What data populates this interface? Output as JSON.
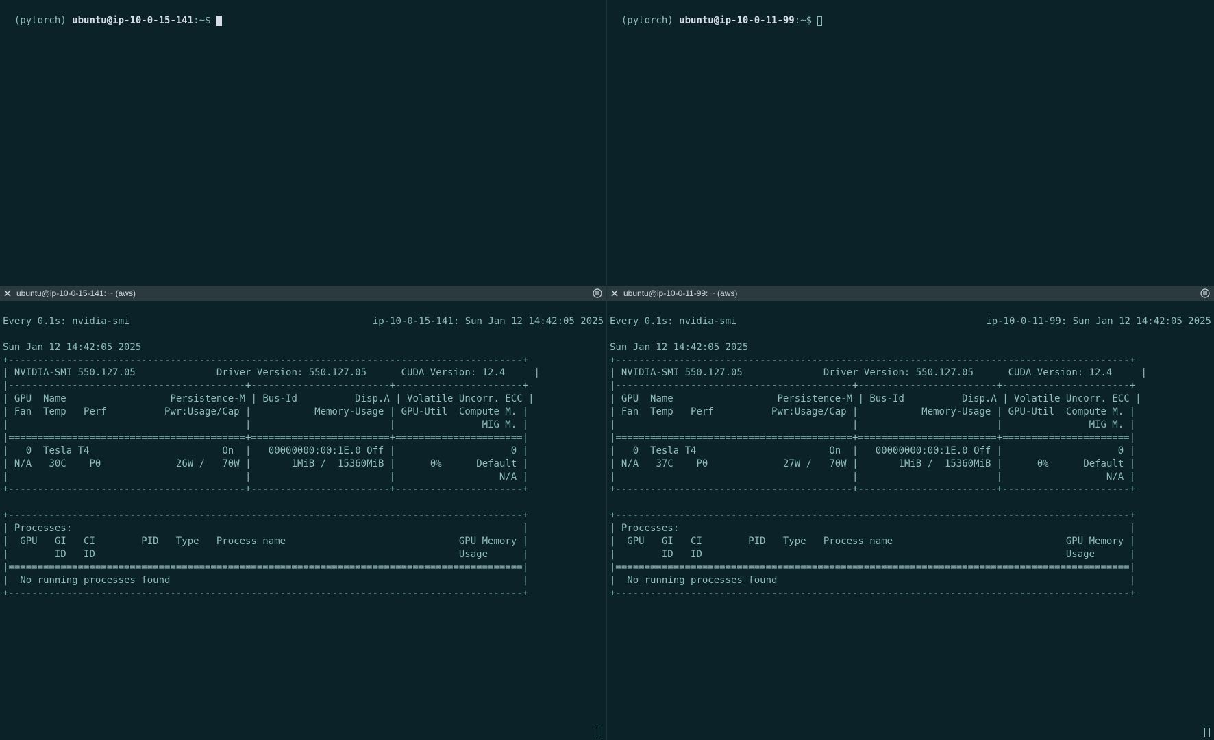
{
  "panes": {
    "top_left": {
      "prompt_env": "(pytorch) ",
      "prompt_userhost": "ubuntu@ip-10-0-15-141",
      "prompt_tail": ":~$ "
    },
    "top_right": {
      "prompt_env": "(pytorch) ",
      "prompt_userhost": "ubuntu@ip-10-0-11-99",
      "prompt_tail": ":~$ "
    }
  },
  "titlebars": {
    "left": "ubuntu@ip-10-0-15-141: ~ (aws)",
    "right": "ubuntu@ip-10-0-11-99: ~ (aws)"
  },
  "watch": {
    "interval_label": "Every 0.1s: nvidia-smi",
    "left_host_time": "ip-10-0-15-141: Sun Jan 12 14:42:05 2025",
    "right_host_time": "ip-10-0-11-99: Sun Jan 12 14:42:05 2025"
  },
  "smi": {
    "date_line": "Sun Jan 12 14:42:05 2025",
    "nvidia_smi_version": "NVIDIA-SMI 550.127.05",
    "driver_version": "Driver Version: 550.127.05",
    "cuda_version": "CUDA Version: 12.4",
    "header_row1_col1": " GPU  Name                  Persistence-M ",
    "header_row1_col2": " Bus-Id          Disp.A ",
    "header_row1_col3": " Volatile Uncorr. ECC ",
    "header_row2_col1": " Fan  Temp   Perf          Pwr:Usage/Cap ",
    "header_row2_col2": "           Memory-Usage ",
    "header_row2_col3": " GPU-Util  Compute M. ",
    "header_row3_col3": "               MIG M. ",
    "proc_header": "Processes:",
    "proc_cols1": "  GPU   GI   CI        PID   Type   Process name                              GPU Memory ",
    "proc_cols2": "        ID   ID                                                               Usage      ",
    "no_proc": "  No running processes found",
    "left": {
      "gpu_idx": "0",
      "gpu_name": "Tesla T4",
      "persistence": "On",
      "bus_id": "00000000:00:1E.0",
      "disp_a": "Off",
      "ecc": "0",
      "fan": "N/A",
      "temp": "30C",
      "perf": "P0",
      "pwr_usage": "26W",
      "pwr_cap": "70W",
      "mem_used": "1MiB",
      "mem_total": "15360MiB",
      "gpu_util": "0%",
      "compute_mode": "Default",
      "mig_mode": "N/A"
    },
    "right": {
      "gpu_idx": "0",
      "gpu_name": "Tesla T4",
      "persistence": "On",
      "bus_id": "00000000:00:1E.0",
      "disp_a": "Off",
      "ecc": "0",
      "fan": "N/A",
      "temp": "37C",
      "perf": "P0",
      "pwr_usage": "27W",
      "pwr_cap": "70W",
      "mem_used": "1MiB",
      "mem_total": "15360MiB",
      "gpu_util": "0%",
      "compute_mode": "Default",
      "mig_mode": "N/A"
    }
  }
}
